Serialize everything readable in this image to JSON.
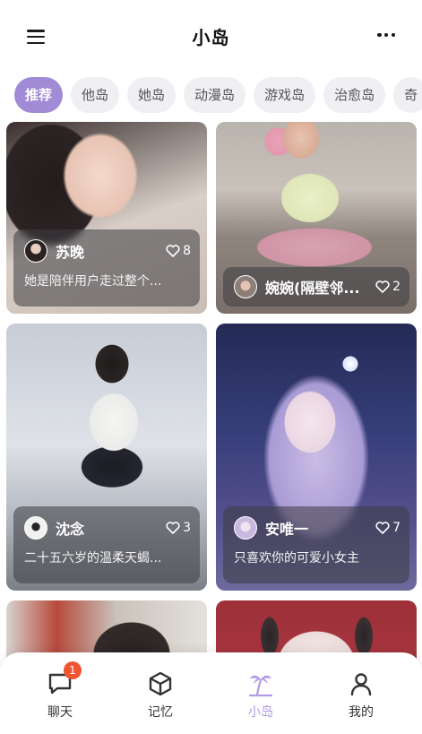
{
  "header": {
    "title": "小岛"
  },
  "tabs": [
    "推荐",
    "他岛",
    "她岛",
    "动漫岛",
    "游戏岛",
    "治愈岛",
    "奇"
  ],
  "cards": [
    {
      "name": "苏晚",
      "likes": "8",
      "desc": "她是陪伴用户走过整个..."
    },
    {
      "name": "婉婉(隔壁邻...",
      "likes": "2",
      "desc": ""
    },
    {
      "name": "沈念",
      "likes": "3",
      "desc": "二十五六岁的温柔天蝎..."
    },
    {
      "name": "安唯一",
      "likes": "7",
      "desc": "只喜欢你的可爱小女主"
    }
  ],
  "nav": {
    "items": [
      "聊天",
      "记忆",
      "小岛",
      "我的"
    ],
    "badge": "1",
    "active": "小岛"
  },
  "colors": {
    "accent": "#a18ad6",
    "badge": "#ef5533",
    "nav_active": "#b39ae6"
  }
}
